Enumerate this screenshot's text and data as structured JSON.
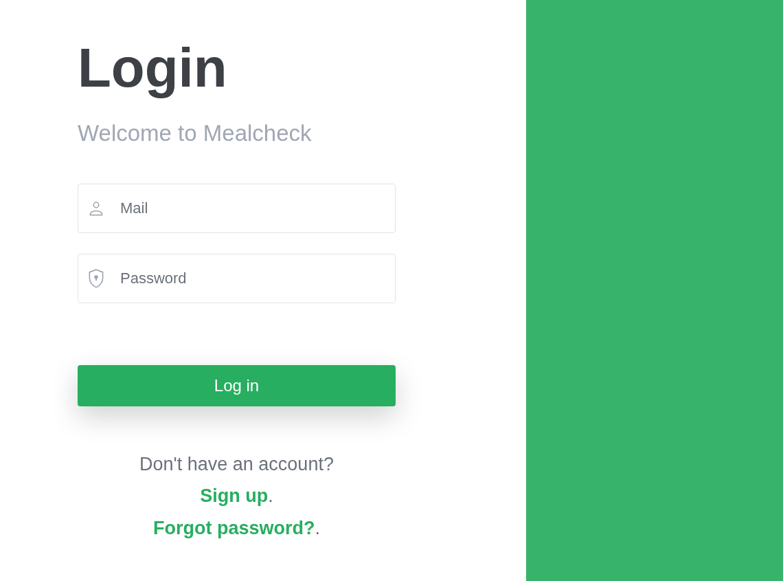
{
  "title": "Login",
  "subtitle": "Welcome to Mealcheck",
  "fields": [
    {
      "kind": "user",
      "placeholder": "Mail"
    },
    {
      "kind": "password",
      "placeholder": "Password"
    }
  ],
  "submit": "Log in",
  "prompt": "Don't have an account?",
  "links": [
    {
      "label": "Sign up",
      "suffix": "."
    },
    {
      "label": "Forgot password?",
      "suffix": "."
    }
  ]
}
